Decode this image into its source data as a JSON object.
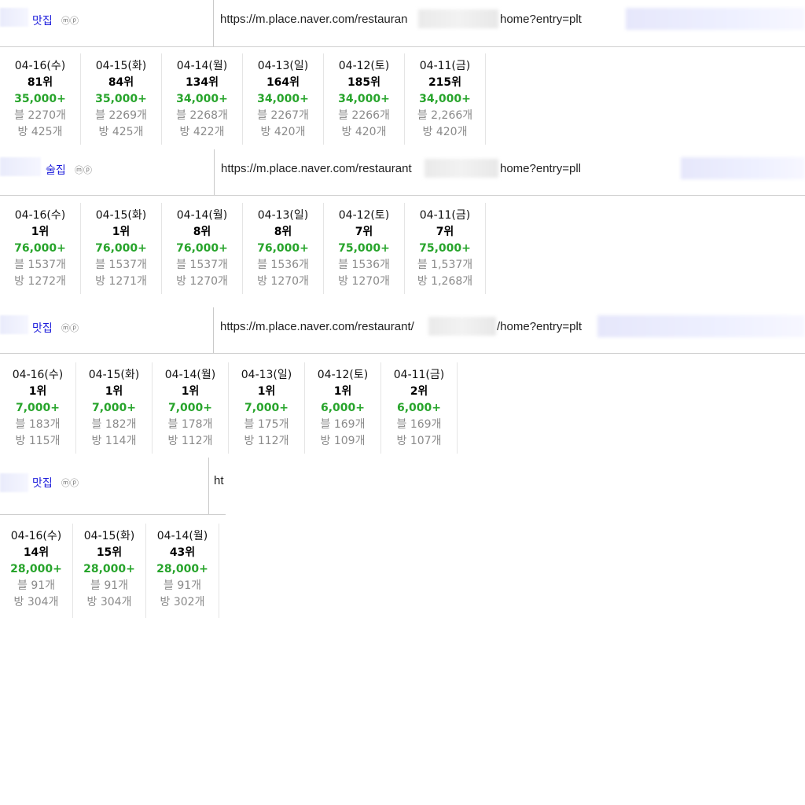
{
  "blocks": [
    {
      "keyword": "맛집",
      "badges": "ⓜⓟ",
      "url_prefix": "https://m.place.naver.com/restauran",
      "url_suffix": "home?entry=plt",
      "days": [
        {
          "date": "04-16(수)",
          "rank": "81위",
          "count": "35,000+",
          "blog": "블 2270개",
          "room": "방 425개"
        },
        {
          "date": "04-15(화)",
          "rank": "84위",
          "count": "35,000+",
          "blog": "블 2269개",
          "room": "방 425개"
        },
        {
          "date": "04-14(월)",
          "rank": "134위",
          "count": "34,000+",
          "blog": "블 2268개",
          "room": "방 422개"
        },
        {
          "date": "04-13(일)",
          "rank": "164위",
          "count": "34,000+",
          "blog": "블 2267개",
          "room": "방 420개"
        },
        {
          "date": "04-12(토)",
          "rank": "185위",
          "count": "34,000+",
          "blog": "블 2266개",
          "room": "방 420개"
        },
        {
          "date": "04-11(금)",
          "rank": "215위",
          "count": "34,000+",
          "blog": "블 2,266개",
          "room": "방 420개"
        }
      ]
    },
    {
      "keyword": "술집",
      "badges": "ⓜⓟ",
      "url_prefix": "https://m.place.naver.com/restaurant",
      "url_suffix": "home?entry=pll",
      "days": [
        {
          "date": "04-16(수)",
          "rank": "1위",
          "count": "76,000+",
          "blog": "블 1537개",
          "room": "방 1272개"
        },
        {
          "date": "04-15(화)",
          "rank": "1위",
          "count": "76,000+",
          "blog": "블 1537개",
          "room": "방 1271개"
        },
        {
          "date": "04-14(월)",
          "rank": "8위",
          "count": "76,000+",
          "blog": "블 1537개",
          "room": "방 1270개"
        },
        {
          "date": "04-13(일)",
          "rank": "8위",
          "count": "76,000+",
          "blog": "블 1536개",
          "room": "방 1270개"
        },
        {
          "date": "04-12(토)",
          "rank": "7위",
          "count": "75,000+",
          "blog": "블 1536개",
          "room": "방 1270개"
        },
        {
          "date": "04-11(금)",
          "rank": "7위",
          "count": "75,000+",
          "blog": "블 1,537개",
          "room": "방 1,268개"
        }
      ]
    },
    {
      "keyword": "맛집",
      "badges": "ⓜⓟ",
      "url_prefix": "https://m.place.naver.com/restaurant/",
      "url_suffix": "/home?entry=plt",
      "days": [
        {
          "date": "04-16(수)",
          "rank": "1위",
          "count": "7,000+",
          "blog": "블 183개",
          "room": "방 115개"
        },
        {
          "date": "04-15(화)",
          "rank": "1위",
          "count": "7,000+",
          "blog": "블 182개",
          "room": "방 114개"
        },
        {
          "date": "04-14(월)",
          "rank": "1위",
          "count": "7,000+",
          "blog": "블 178개",
          "room": "방 112개"
        },
        {
          "date": "04-13(일)",
          "rank": "1위",
          "count": "7,000+",
          "blog": "블 175개",
          "room": "방 112개"
        },
        {
          "date": "04-12(토)",
          "rank": "1위",
          "count": "6,000+",
          "blog": "블 169개",
          "room": "방 109개"
        },
        {
          "date": "04-11(금)",
          "rank": "2위",
          "count": "6,000+",
          "blog": "블 169개",
          "room": "방 107개"
        }
      ]
    },
    {
      "keyword": "맛집",
      "badges": "ⓜⓟ",
      "url_prefix": "ht",
      "url_suffix": "",
      "days": [
        {
          "date": "04-16(수)",
          "rank": "14위",
          "count": "28,000+",
          "blog": "블 91개",
          "room": "방 304개"
        },
        {
          "date": "04-15(화)",
          "rank": "15위",
          "count": "28,000+",
          "blog": "블 91개",
          "room": "방 304개"
        },
        {
          "date": "04-14(월)",
          "rank": "43위",
          "count": "28,000+",
          "blog": "블 91개",
          "room": "방 302개"
        }
      ]
    }
  ]
}
